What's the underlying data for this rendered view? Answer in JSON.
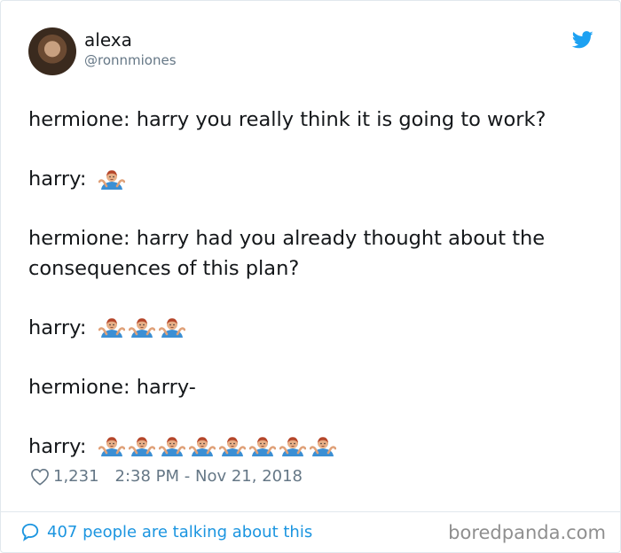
{
  "tweet": {
    "display_name": "alexa",
    "handle": "@ronnmiones",
    "lines": {
      "l1": "hermione: harry you really think it is going to work?",
      "l2": "harry:",
      "l3": "hermione: harry had you already thought about the",
      "l4": "consequences of this plan?",
      "l5": "harry:",
      "l6": "hermione: harry-",
      "l7": "harry:"
    },
    "emoji_icon": "man-shrugging-emoji",
    "emoji_counts": [
      1,
      3,
      8
    ],
    "likes": "1,231",
    "timestamp": "2:38 PM - Nov 21, 2018"
  },
  "footer": {
    "talking": "407 people are talking about this",
    "watermark": "boredpanda.com"
  },
  "colors": {
    "text": "#14171a",
    "muted": "#657786",
    "twitter_blue": "#1da1f2",
    "link_blue": "#1b95e0",
    "border": "#e1e8ed"
  }
}
